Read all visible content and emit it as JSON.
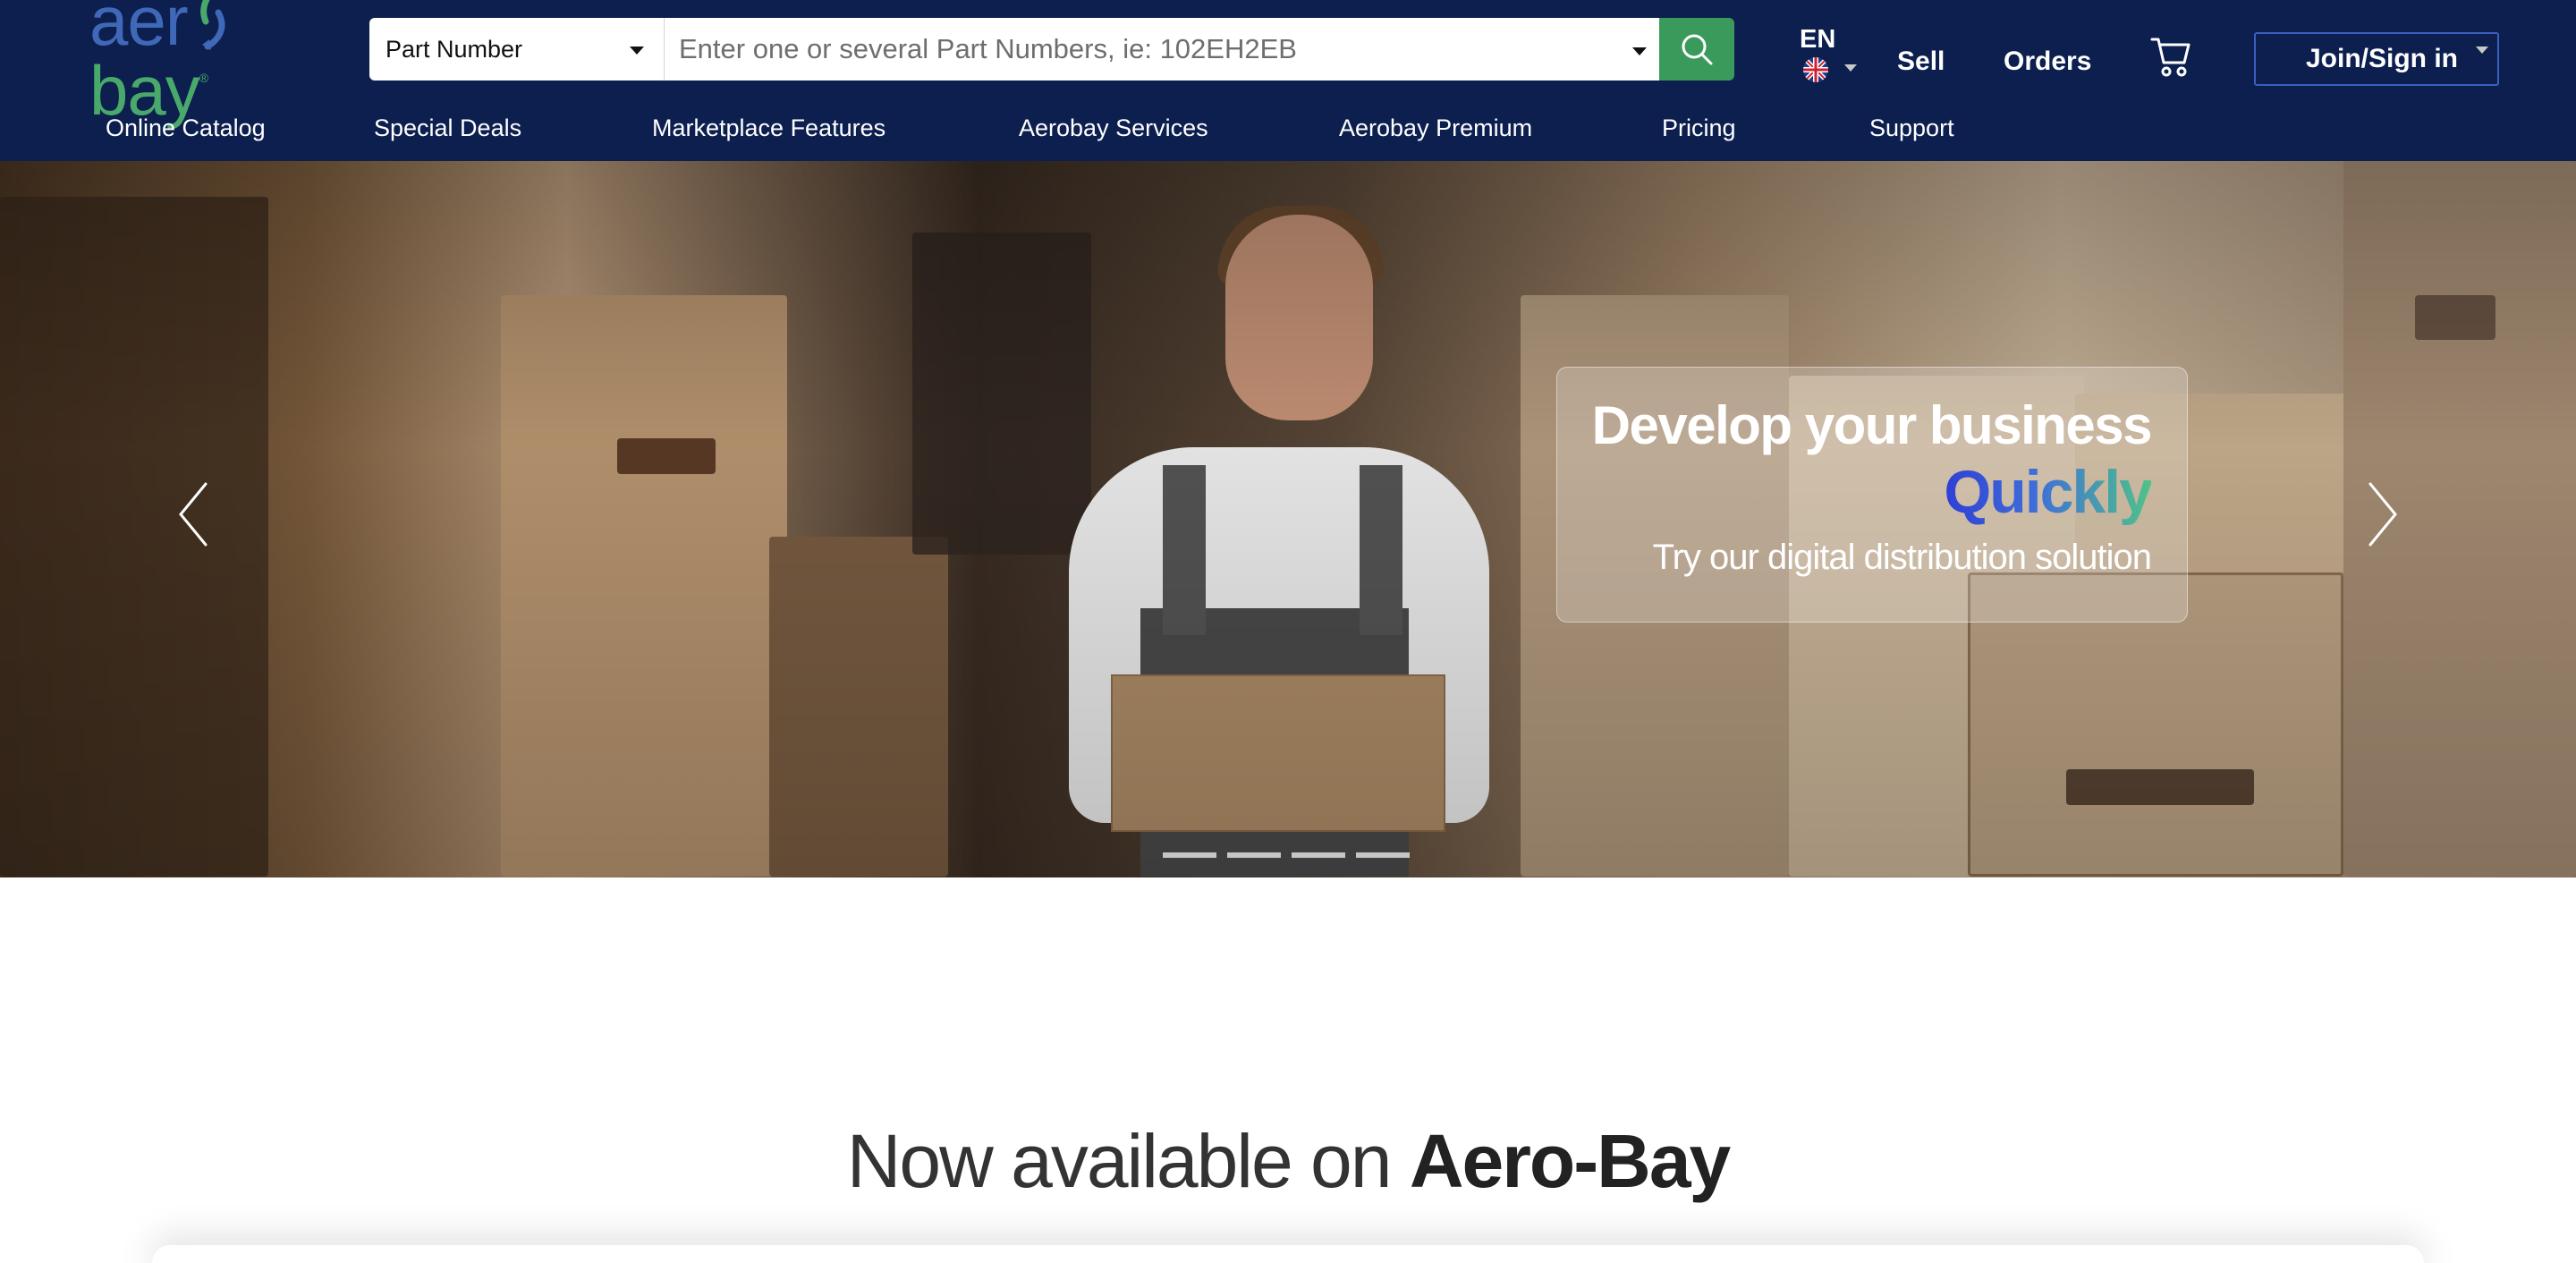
{
  "brand": {
    "logo_part1": "aer",
    "logo_part2": "bay",
    "logo_reg": "®"
  },
  "search": {
    "type_selected": "Part Number",
    "placeholder": "Enter one or several Part Numbers, ie: 102EH2EB",
    "button_icon": "search-icon"
  },
  "language": {
    "code": "EN",
    "flag_icon": "uk-flag-icon"
  },
  "top_links": {
    "sell": "Sell",
    "orders": "Orders",
    "cart_icon": "cart-icon"
  },
  "account": {
    "join_label": "Join/Sign in"
  },
  "nav": {
    "items": [
      {
        "label": "Online Catalog"
      },
      {
        "label": "Special Deals"
      },
      {
        "label": "Marketplace Features"
      },
      {
        "label": "Aerobay Services"
      },
      {
        "label": "Aerobay Premium"
      },
      {
        "label": "Pricing"
      },
      {
        "label": "Support"
      }
    ]
  },
  "hero": {
    "title": "Develop your business",
    "accent": "Quickly",
    "subtitle": "Try our digital distribution solution",
    "slide_count": 4
  },
  "section": {
    "heading_light": "Now available on",
    "heading_bold": "Aero-Bay"
  },
  "colors": {
    "header_bg": "#0c1f4f",
    "search_button": "#3a9a5c",
    "logo_blue": "#3f68b8",
    "logo_green": "#49a96b",
    "join_border": "#3c5fc0"
  }
}
